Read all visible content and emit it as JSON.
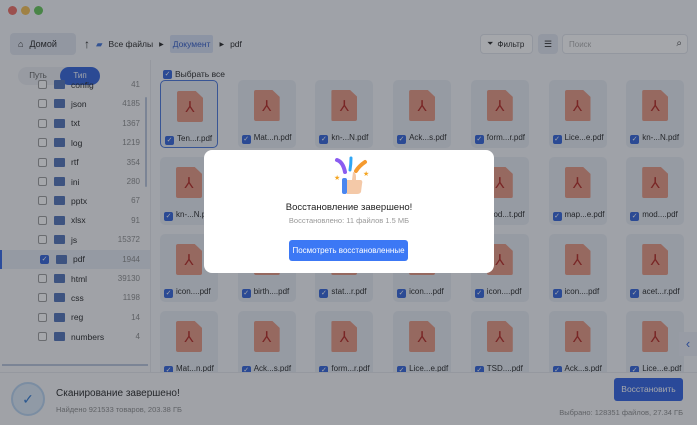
{
  "toolbar": {
    "home": "Домой",
    "crumbs": [
      "Все файлы",
      "Документ",
      "pdf"
    ],
    "filter": "Фильтр",
    "search_placeholder": "Поиск"
  },
  "sidebar": {
    "tabs": [
      "Путь",
      "Тип"
    ],
    "active_tab": "Тип",
    "items": [
      {
        "name": "config",
        "count": "41",
        "checked": false
      },
      {
        "name": "json",
        "count": "4185",
        "checked": false
      },
      {
        "name": "txt",
        "count": "1367",
        "checked": false
      },
      {
        "name": "log",
        "count": "1219",
        "checked": false
      },
      {
        "name": "rtf",
        "count": "354",
        "checked": false
      },
      {
        "name": "ini",
        "count": "280",
        "checked": false
      },
      {
        "name": "pptx",
        "count": "67",
        "checked": false
      },
      {
        "name": "xlsx",
        "count": "91",
        "checked": false
      },
      {
        "name": "js",
        "count": "15372",
        "checked": false
      },
      {
        "name": "pdf",
        "count": "1944",
        "checked": true
      },
      {
        "name": "html",
        "count": "39130",
        "checked": false
      },
      {
        "name": "css",
        "count": "1198",
        "checked": false
      },
      {
        "name": "reg",
        "count": "14",
        "checked": false
      },
      {
        "name": "numbers",
        "count": "4",
        "checked": false
      }
    ]
  },
  "content": {
    "select_all": "Выбрать все",
    "files": [
      [
        "Ten...r.pdf",
        "Mat...n.pdf",
        "kn-...N.pdf",
        "Ack...s.pdf",
        "form...r.pdf",
        "Lice...e.pdf",
        "kn-...N.pdf"
      ],
      [
        "kn-...N.pdf",
        "",
        "",
        "",
        "mod...t.pdf",
        "map...e.pdf",
        "mod....pdf"
      ],
      [
        "icon....pdf",
        "birth....pdf",
        "stat...r.pdf",
        "icon....pdf",
        "icon....pdf",
        "icon....pdf",
        "acet...r.pdf"
      ],
      [
        "Mat...n.pdf",
        "Ack...s.pdf",
        "form...r.pdf",
        "Lice...e.pdf",
        "TSD....pdf",
        "Ack...s.pdf",
        "Lice...e.pdf"
      ]
    ]
  },
  "bottom": {
    "title": "Сканирование завершено!",
    "found": "Найдено 921533 товаров, 203.38 ГБ",
    "restore": "Восстановить",
    "selected": "Выбрано: 128351 файлов, 27.34 ГБ"
  },
  "modal": {
    "title": "Восстановление завершено!",
    "subtitle": "Восстановлено: 11 файлов 1.5 МБ",
    "button": "Посмотреть восстановленные"
  }
}
